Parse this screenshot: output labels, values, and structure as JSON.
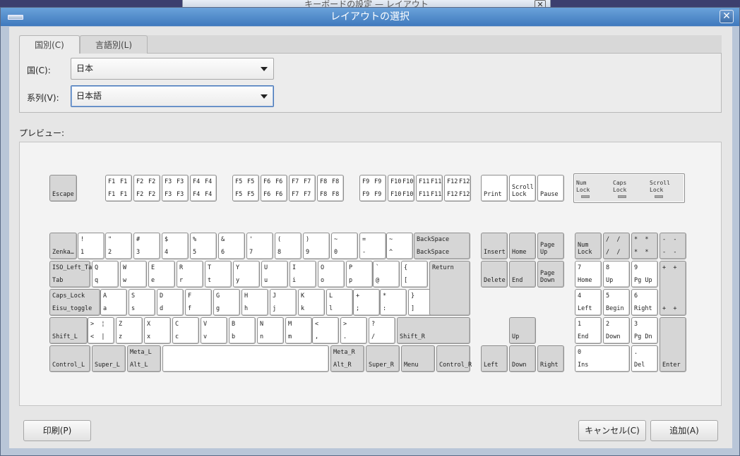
{
  "background_window": {
    "title": "キーボードの設定 — レイアウト"
  },
  "window": {
    "title": "レイアウトの選択",
    "close_label": "✕"
  },
  "tabs": [
    {
      "label": "国別(C)"
    },
    {
      "label": "言語別(L)"
    }
  ],
  "fields": {
    "country": {
      "label": "国(C):",
      "value": "日本"
    },
    "variant": {
      "label": "系列(V):",
      "value": "日本語"
    }
  },
  "preview_label": "プレビュー:",
  "keyboard": {
    "function_row": [
      {
        "id": "esc",
        "bl": "Escape"
      },
      {
        "id": "f1",
        "tl": "F1",
        "tr": "F1",
        "bl": "F1",
        "br": "F1"
      },
      {
        "id": "f2",
        "tl": "F2",
        "tr": "F2",
        "bl": "F2",
        "br": "F2"
      },
      {
        "id": "f3",
        "tl": "F3",
        "tr": "F3",
        "bl": "F3",
        "br": "F3"
      },
      {
        "id": "f4",
        "tl": "F4",
        "tr": "F4",
        "bl": "F4",
        "br": "F4"
      },
      {
        "id": "f5",
        "tl": "F5",
        "tr": "F5",
        "bl": "F5",
        "br": "F5"
      },
      {
        "id": "f6",
        "tl": "F6",
        "tr": "F6",
        "bl": "F6",
        "br": "F6"
      },
      {
        "id": "f7",
        "tl": "F7",
        "tr": "F7",
        "bl": "F7",
        "br": "F7"
      },
      {
        "id": "f8",
        "tl": "F8",
        "tr": "F8",
        "bl": "F8",
        "br": "F8"
      },
      {
        "id": "f9",
        "tl": "F9",
        "tr": "F9",
        "bl": "F9",
        "br": "F9"
      },
      {
        "id": "f10",
        "tl": "F10",
        "tr": "F10",
        "bl": "F10",
        "br": "F10"
      },
      {
        "id": "f11",
        "tl": "F11",
        "tr": "F11",
        "bl": "F11",
        "br": "F11"
      },
      {
        "id": "f12",
        "tl": "F12",
        "tr": "F12",
        "bl": "F12",
        "br": "F12"
      },
      {
        "id": "print",
        "bl": "Print"
      },
      {
        "id": "scroll",
        "tl": "",
        "bl": "Scroll\nLock"
      },
      {
        "id": "pause",
        "bl": "Pause"
      }
    ],
    "leds": [
      {
        "label": "Num\nLock"
      },
      {
        "label": "Caps\nLock"
      },
      {
        "label": "Scroll\nLock"
      }
    ],
    "number_row": [
      {
        "id": "zenkaku",
        "bl": "Zenka…"
      },
      {
        "id": "k1",
        "tl": "!",
        "bl": "1"
      },
      {
        "id": "k2",
        "tl": "\"",
        "bl": "2"
      },
      {
        "id": "k3",
        "tl": "#",
        "bl": "3"
      },
      {
        "id": "k4",
        "tl": "$",
        "bl": "4"
      },
      {
        "id": "k5",
        "tl": "%",
        "bl": "5"
      },
      {
        "id": "k6",
        "tl": "&",
        "bl": "6"
      },
      {
        "id": "k7",
        "tl": "'",
        "bl": "7"
      },
      {
        "id": "k8",
        "tl": "(",
        "bl": "8"
      },
      {
        "id": "k9",
        "tl": ")",
        "bl": "9"
      },
      {
        "id": "k0",
        "tl": "~",
        "bl": "0"
      },
      {
        "id": "kminus",
        "tl": "=",
        "bl": "-"
      },
      {
        "id": "kcaret",
        "tl": "~",
        "bl": "^"
      },
      {
        "id": "backspace",
        "tl": "BackSpace",
        "bl": "BackSpace"
      }
    ],
    "qwerty_row": [
      {
        "id": "tab",
        "tl": "ISO_Left_Tab",
        "bl": "Tab"
      },
      {
        "id": "q",
        "tl": "Q",
        "bl": "q"
      },
      {
        "id": "w",
        "tl": "W",
        "bl": "w"
      },
      {
        "id": "e",
        "tl": "E",
        "bl": "e"
      },
      {
        "id": "r",
        "tl": "R",
        "bl": "r"
      },
      {
        "id": "t",
        "tl": "T",
        "bl": "t"
      },
      {
        "id": "y",
        "tl": "Y",
        "bl": "y"
      },
      {
        "id": "u",
        "tl": "U",
        "bl": "u"
      },
      {
        "id": "i",
        "tl": "I",
        "bl": "i"
      },
      {
        "id": "o",
        "tl": "O",
        "bl": "o"
      },
      {
        "id": "p",
        "tl": "P",
        "bl": "p"
      },
      {
        "id": "at",
        "tl": "`",
        "bl": "@"
      },
      {
        "id": "lbracket",
        "tl": "{",
        "bl": "["
      }
    ],
    "home_row": [
      {
        "id": "caps",
        "tl": "Caps_Lock",
        "bl": "Eisu_toggle"
      },
      {
        "id": "a",
        "tl": "A",
        "bl": "a"
      },
      {
        "id": "s",
        "tl": "S",
        "bl": "s"
      },
      {
        "id": "d",
        "tl": "D",
        "bl": "d"
      },
      {
        "id": "f",
        "tl": "F",
        "bl": "f"
      },
      {
        "id": "g",
        "tl": "G",
        "bl": "g"
      },
      {
        "id": "h",
        "tl": "H",
        "bl": "h"
      },
      {
        "id": "j",
        "tl": "J",
        "bl": "j"
      },
      {
        "id": "k",
        "tl": "K",
        "bl": "k"
      },
      {
        "id": "l",
        "tl": "L",
        "bl": "l"
      },
      {
        "id": "semicolon",
        "tl": "+",
        "bl": ";"
      },
      {
        "id": "colon",
        "tl": "*",
        "bl": ":"
      },
      {
        "id": "rbracket",
        "tl": "}",
        "bl": "]"
      },
      {
        "id": "return",
        "tl": "Return"
      }
    ],
    "shift_row": [
      {
        "id": "shiftl",
        "bl": "Shift_L"
      },
      {
        "id": "lsgt",
        "tl": ">  ¦",
        "bl": "<  |"
      },
      {
        "id": "z",
        "tl": "Z",
        "bl": "z"
      },
      {
        "id": "x",
        "tl": "X",
        "bl": "x"
      },
      {
        "id": "c",
        "tl": "C",
        "bl": "c"
      },
      {
        "id": "v",
        "tl": "V",
        "bl": "v"
      },
      {
        "id": "b",
        "tl": "B",
        "bl": "b"
      },
      {
        "id": "n",
        "tl": "N",
        "bl": "n"
      },
      {
        "id": "m",
        "tl": "M",
        "bl": "m"
      },
      {
        "id": "comma",
        "tl": "<",
        "bl": ","
      },
      {
        "id": "period",
        "tl": ">",
        "bl": "."
      },
      {
        "id": "slash",
        "tl": "?",
        "bl": "/"
      },
      {
        "id": "shiftr",
        "bl": "Shift_R"
      }
    ],
    "bottom_row": [
      {
        "id": "ctrll",
        "bl": "Control_L"
      },
      {
        "id": "superl",
        "bl": "Super_L"
      },
      {
        "id": "altl",
        "tl": "Meta_L",
        "bl": "Alt_L"
      },
      {
        "id": "space"
      },
      {
        "id": "altr",
        "tl": "Meta_R",
        "bl": "Alt_R"
      },
      {
        "id": "superr",
        "bl": "Super_R"
      },
      {
        "id": "menu",
        "bl": "Menu"
      },
      {
        "id": "ctrlr",
        "bl": "Control_R"
      }
    ],
    "nav_cluster": [
      {
        "id": "insert",
        "bl": "Insert"
      },
      {
        "id": "home",
        "bl": "Home"
      },
      {
        "id": "pgup",
        "bl": "Page\nUp"
      },
      {
        "id": "delete",
        "bl": "Delete"
      },
      {
        "id": "end",
        "bl": "End"
      },
      {
        "id": "pgdn",
        "bl": "Page\nDown"
      },
      {
        "id": "up",
        "bl": "Up"
      },
      {
        "id": "left",
        "bl": "Left"
      },
      {
        "id": "down",
        "bl": "Down"
      },
      {
        "id": "right",
        "bl": "Right"
      }
    ],
    "numpad": [
      {
        "id": "numlock",
        "bl": "Num\nLock"
      },
      {
        "id": "kpdiv",
        "tl": "/  /",
        "bl": "/  /"
      },
      {
        "id": "kpmul",
        "tl": "*  *",
        "bl": "*  *"
      },
      {
        "id": "kpsub",
        "tl": "-  -",
        "bl": "-  -"
      },
      {
        "id": "kp7",
        "tl": "7",
        "bl": "Home"
      },
      {
        "id": "kp8",
        "tl": "8",
        "bl": "Up"
      },
      {
        "id": "kp9",
        "tl": "9",
        "bl": "Pg Up"
      },
      {
        "id": "kpadd",
        "tl": "+  +",
        "bl": "+  +"
      },
      {
        "id": "kp4",
        "tl": "4",
        "bl": "Left"
      },
      {
        "id": "kp5",
        "tl": "5",
        "bl": "Begin"
      },
      {
        "id": "kp6",
        "tl": "6",
        "bl": "Right"
      },
      {
        "id": "kp1",
        "tl": "1",
        "bl": "End"
      },
      {
        "id": "kp2",
        "tl": "2",
        "bl": "Down"
      },
      {
        "id": "kp3",
        "tl": "3",
        "bl": "Pg Dn"
      },
      {
        "id": "kpenter",
        "bl": "Enter"
      },
      {
        "id": "kp0",
        "tl": "0",
        "bl": "Ins"
      },
      {
        "id": "kpdec",
        "tl": ".",
        "bl": "Del"
      }
    ]
  },
  "buttons": {
    "print": "印刷(P)",
    "cancel": "キャンセル(C)",
    "add": "追加(A)"
  }
}
